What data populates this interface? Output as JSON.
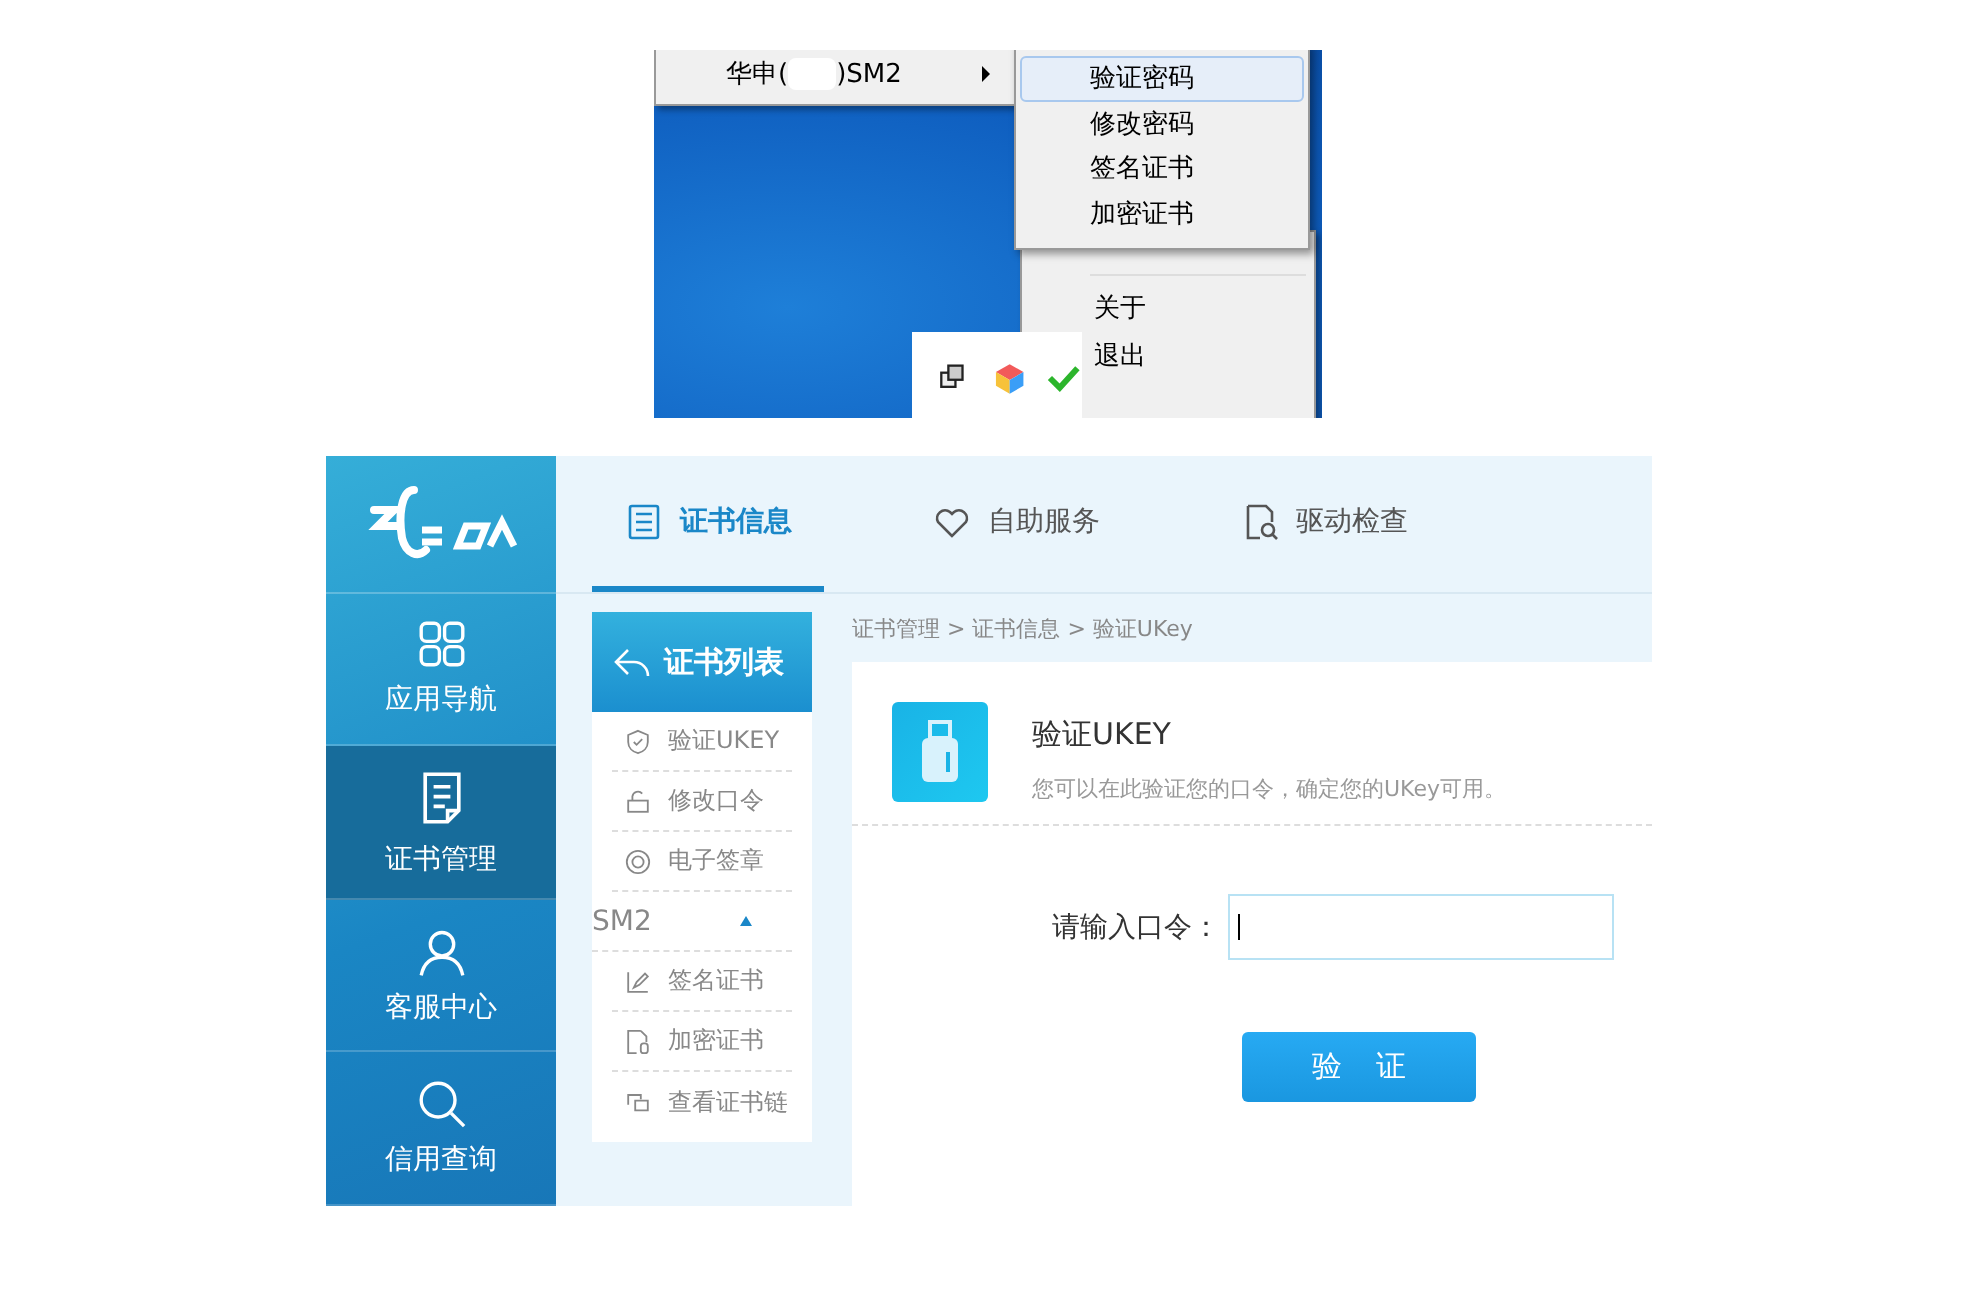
{
  "tray_menu": {
    "item": {
      "label_start": "华申(",
      "label_end": ")SM2",
      "selected": false
    },
    "submenu": [
      {
        "label": "验证密码",
        "selected": true
      },
      {
        "label": "修改密码",
        "selected": false
      },
      {
        "label": "签名证书",
        "selected": false
      },
      {
        "label": "加密证书",
        "selected": false
      }
    ],
    "items": [
      {
        "label": "关于"
      },
      {
        "label": "退出"
      }
    ]
  },
  "app": {
    "sidebar": [
      {
        "label": "应用导航",
        "selected": false
      },
      {
        "label": "证书管理",
        "selected": true
      },
      {
        "label": "客服中心",
        "selected": false
      },
      {
        "label": "信用查询",
        "selected": false
      }
    ],
    "tabs": [
      {
        "label": "证书信息",
        "selected": true
      },
      {
        "label": "自助服务",
        "selected": false
      },
      {
        "label": "驱动检查",
        "selected": false
      }
    ],
    "panel": {
      "title": "证书列表",
      "items": [
        {
          "kind": "item",
          "label": "验证UKEY"
        },
        {
          "kind": "item",
          "label": "修改口令"
        },
        {
          "kind": "item",
          "label": "电子签章"
        },
        {
          "kind": "group",
          "label": "SM2",
          "expanded": true
        },
        {
          "kind": "item",
          "label": "签名证书"
        },
        {
          "kind": "item",
          "label": "加密证书"
        },
        {
          "kind": "item",
          "label": "查看证书链"
        }
      ]
    },
    "breadcrumb": "证书管理 > 证书信息 > 验证UKey",
    "card": {
      "title": "验证UKEY",
      "description": "您可以在此验证您的口令，确定您的UKey可用。",
      "field_label": "请输入口令：",
      "button": "验 证"
    }
  }
}
